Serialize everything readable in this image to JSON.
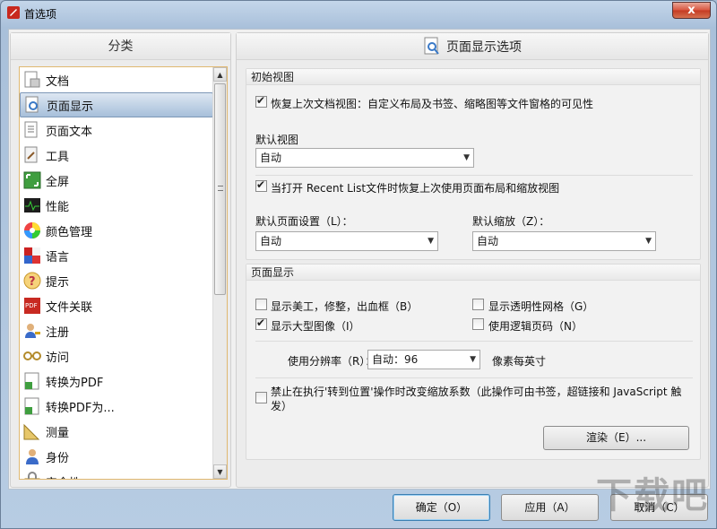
{
  "window": {
    "title": "首选项",
    "close": "x"
  },
  "categories": {
    "header": "分类",
    "items": [
      {
        "label": "文档",
        "icon": "document-icon"
      },
      {
        "label": "页面显示",
        "icon": "page-display-icon",
        "selected": true
      },
      {
        "label": "页面文本",
        "icon": "page-text-icon"
      },
      {
        "label": "工具",
        "icon": "tools-icon"
      },
      {
        "label": "全屏",
        "icon": "fullscreen-icon"
      },
      {
        "label": "性能",
        "icon": "performance-icon"
      },
      {
        "label": "颜色管理",
        "icon": "color-wheel-icon"
      },
      {
        "label": "语言",
        "icon": "language-icon"
      },
      {
        "label": "提示",
        "icon": "question-icon"
      },
      {
        "label": "文件关联",
        "icon": "pdf-icon"
      },
      {
        "label": "注册",
        "icon": "user-key-icon"
      },
      {
        "label": "访问",
        "icon": "glasses-icon"
      },
      {
        "label": "转换为PDF",
        "icon": "convert-to-pdf-icon"
      },
      {
        "label": "转换PDF为...",
        "icon": "convert-from-pdf-icon"
      },
      {
        "label": "测量",
        "icon": "ruler-icon"
      },
      {
        "label": "身份",
        "icon": "identity-icon"
      },
      {
        "label": "安全性",
        "icon": "security-icon"
      }
    ]
  },
  "panel": {
    "title": "页面显示选项",
    "initial_view": {
      "title": "初始视图",
      "restore_label": "恢复上次文档视图：自定义布局及书签、缩略图等文件窗格的可见性",
      "restore_checked": true,
      "default_view_label": "默认视图",
      "default_view_value": "自动",
      "recent_label": "当打开 Recent List文件时恢复上次使用页面布局和缩放视图",
      "recent_checked": true,
      "page_setting_label": "默认页面设置（L）：",
      "page_setting_value": "自动",
      "zoom_label": "默认缩放（Z）：",
      "zoom_value": "自动"
    },
    "page_display": {
      "title": "页面显示",
      "art_trim_bleed_label": "显示美工，修整，出血框（B）",
      "art_trim_bleed_checked": false,
      "transparency_grid_label": "显示透明性网格（G）",
      "transparency_grid_checked": false,
      "large_images_label": "显示大型图像（I）",
      "large_images_checked": true,
      "logical_page_label": "使用逻辑页码（N）",
      "logical_page_checked": false,
      "resolution_label": "使用分辨率（R）：",
      "resolution_value": "自动：96",
      "resolution_unit": "像素每英寸",
      "disable_zoom_label": "禁止在执行'转到位置'操作时改变缩放系数（此操作可由书签，超链接和 JavaScript 触发）",
      "disable_zoom_checked": false,
      "render_button": "渲染（E）..."
    }
  },
  "footer": {
    "ok": "确定（O）",
    "apply": "应用（A）",
    "cancel": "取消（C）"
  },
  "watermark": "下载吧"
}
